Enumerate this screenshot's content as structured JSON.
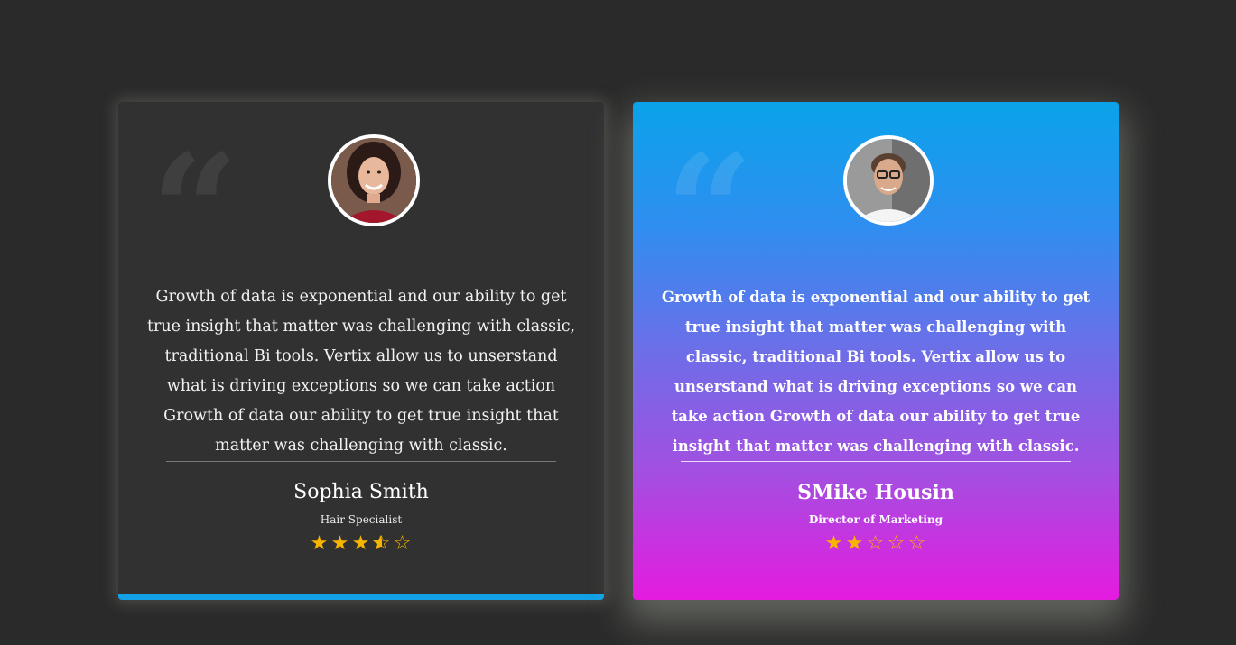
{
  "testimonials": [
    {
      "quote_icon": "quote-icon",
      "avatar": "avatar-woman",
      "review": "Growth of data is exponential and our ability to get true insight that matter was challenging with classic, traditional Bi tools. Vertix allow us to unserstand what is driving exceptions so we can take action Growth of data our ability to get true insight that matter was challenging with classic.",
      "name": "Sophia Smith",
      "role": "Hair Specialist",
      "rating": 3.5,
      "rating_max": 5
    },
    {
      "quote_icon": "quote-icon",
      "avatar": "avatar-man",
      "review": "Growth of data is exponential and our ability to get true insight that matter was challenging with classic, traditional Bi tools. Vertix allow us to unserstand what is driving exceptions so we can take action Growth of data our ability to get true insight that matter was challenging with classic.",
      "name": "SMike Housin",
      "role": "Director of Marketing",
      "rating": 2,
      "rating_max": 5
    }
  ],
  "colors": {
    "background": "#2a2a2a",
    "card_dark": "#313131",
    "accent_blue": "#12a1e6",
    "gradient_top": "#0aa3ea",
    "gradient_bottom": "#e41bdf",
    "star": "#f7b500"
  }
}
